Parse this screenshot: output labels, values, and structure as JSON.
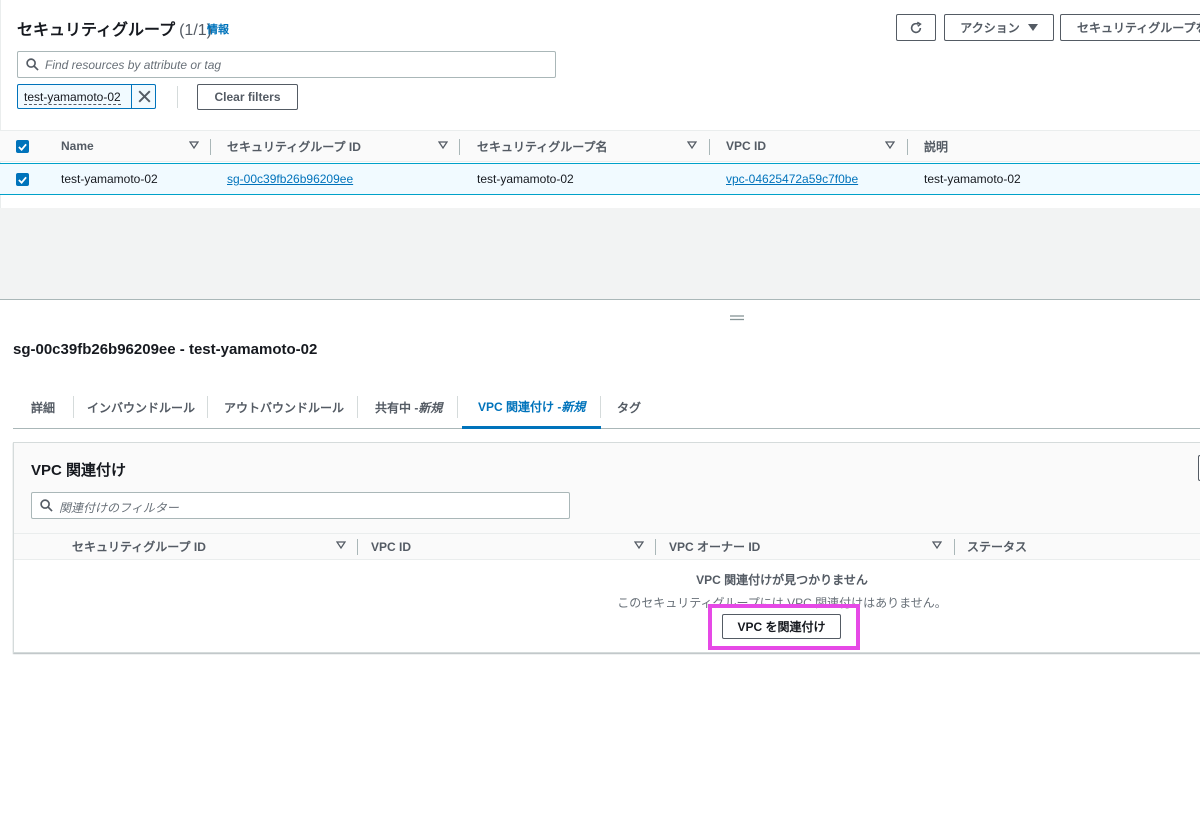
{
  "header": {
    "title": "セキュリティグループ",
    "count": "(1/1)",
    "info_link": "情報",
    "actions_label": "アクション",
    "create_label": "セキュリティグループを"
  },
  "filters": {
    "search_placeholder": "Find resources by attribute or tag",
    "token_label": "test-yamamoto-02",
    "clear_label": "Clear filters"
  },
  "table": {
    "columns": [
      "Name",
      "セキュリティグループ ID",
      "セキュリティグループ名",
      "VPC ID",
      "説明"
    ],
    "rows": [
      {
        "name": "test-yamamoto-02",
        "sg_id": "sg-00c39fb26b96209ee",
        "sg_name": "test-yamamoto-02",
        "vpc_id": "vpc-04625472a59c7f0be",
        "description": "test-yamamoto-02",
        "selected": true
      }
    ]
  },
  "detail": {
    "title": "sg-00c39fb26b96209ee - test-yamamoto-02",
    "tabs": [
      {
        "label": "詳細",
        "new": ""
      },
      {
        "label": "インバウンドルール",
        "new": ""
      },
      {
        "label": "アウトバウンドルール",
        "new": ""
      },
      {
        "label": "共有中 - ",
        "new": "新規"
      },
      {
        "label": "VPC 関連付け - ",
        "new": "新規",
        "active": true
      },
      {
        "label": "タグ",
        "new": ""
      }
    ]
  },
  "vpc_assoc": {
    "title": "VPC 関連付け",
    "filter_placeholder": "関連付けのフィルター",
    "columns": [
      "セキュリティグループ ID",
      "VPC ID",
      "VPC オーナー ID",
      "ステータス"
    ],
    "empty_title": "VPC 関連付けが見つかりません",
    "empty_desc": "このセキュリティグループには VPC 関連付けはありません。",
    "button_label": "VPC を関連付け"
  },
  "colors": {
    "accent": "#0073bb",
    "highlight": "#e649e6"
  }
}
